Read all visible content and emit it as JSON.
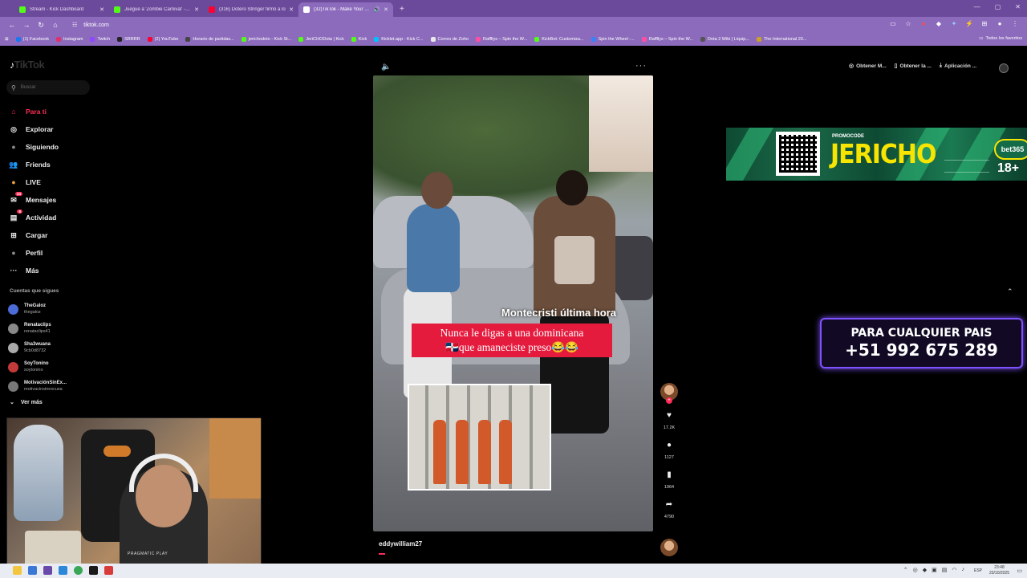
{
  "browser": {
    "tabs": [
      {
        "title": "Stream - Kick Dashboard",
        "color": "#53fc18",
        "active": false
      },
      {
        "title": "Juegue a 'Zombie Carnival' - Ju",
        "color": "#53fc18",
        "active": false
      },
      {
        "title": "(316) Dotero Stringer firmó a lo",
        "color": "#ff0033",
        "active": false
      },
      {
        "title": "(32)TikTok - Make Your Day",
        "color": "#ffffff",
        "active": true
      }
    ],
    "url": "tiktok.com",
    "bookmarks": [
      {
        "label": "(1) Facebook",
        "color": "#1877f2"
      },
      {
        "label": "Instagram",
        "color": "#e1306c"
      },
      {
        "label": "Twitch",
        "color": "#9146ff"
      },
      {
        "label": "SRRRR",
        "color": "#222222"
      },
      {
        "label": "(2) YouTube",
        "color": "#ff0033"
      },
      {
        "label": "Horario de partidas...",
        "color": "#444444"
      },
      {
        "label": "jerichodoto - Kick St...",
        "color": "#53fc18"
      },
      {
        "label": "JeriCHODota | Kick",
        "color": "#53fc18"
      },
      {
        "label": "Kick",
        "color": "#53fc18"
      },
      {
        "label": "Kicklet.app - Kick C...",
        "color": "#00c2ff"
      },
      {
        "label": "Correo de Zoho",
        "color": "#e8e8e8"
      },
      {
        "label": "Raffllys – Spin the W...",
        "color": "#ff4fa3"
      },
      {
        "label": "KickBot: Customiza...",
        "color": "#53fc18"
      },
      {
        "label": "Spin the Wheel -...",
        "color": "#3b82f6"
      },
      {
        "label": "Raffllys – Spin the W...",
        "color": "#ff4fa3"
      },
      {
        "label": "Dota 2 Wiki | Liquip...",
        "color": "#555555"
      },
      {
        "label": "The International 20...",
        "color": "#c9a227"
      }
    ],
    "all_bookmarks": "Todos los favoritos"
  },
  "tiktok": {
    "logo": "TikTok",
    "search_placeholder": "Buscar",
    "nav": [
      {
        "label": "Para ti",
        "icon": "home-icon",
        "glyph": "⌂",
        "active": true
      },
      {
        "label": "Explorar",
        "icon": "compass-icon",
        "glyph": "◎",
        "active": false
      },
      {
        "label": "Siguiendo",
        "icon": "following-icon",
        "glyph": "●",
        "active": false
      },
      {
        "label": "Friends",
        "icon": "friends-icon",
        "glyph": "👥",
        "active": false
      },
      {
        "label": "LIVE",
        "icon": "live-icon",
        "glyph": "●",
        "active": false
      },
      {
        "label": "Mensajes",
        "icon": "messages-icon",
        "glyph": "✉",
        "badge": "24",
        "active": false
      },
      {
        "label": "Actividad",
        "icon": "activity-icon",
        "glyph": "▤",
        "badge": "8",
        "active": false
      },
      {
        "label": "Cargar",
        "icon": "upload-icon",
        "glyph": "⊞",
        "active": false
      },
      {
        "label": "Perfil",
        "icon": "profile-icon",
        "glyph": "●",
        "active": false
      },
      {
        "label": "Más",
        "icon": "more-icon",
        "glyph": "···",
        "active": false
      }
    ],
    "following_title": "Cuentas que sigues",
    "following": [
      {
        "name": "TheGaloz",
        "handle": "thegaloz",
        "color": "#4b6cd6"
      },
      {
        "name": "Renataclips",
        "handle": "renataclips41",
        "color": "#888888"
      },
      {
        "name": "Sha3wuana",
        "handle": "9cb0d8732",
        "color": "#aaaaaa"
      },
      {
        "name": "SoyTonino",
        "handle": "soytonino",
        "color": "#c33a3a"
      },
      {
        "name": "MotivaciónSinEx...",
        "handle": "motivacinsinexcusa",
        "color": "#777777"
      }
    ],
    "see_more": "Ver más",
    "top_actions": [
      {
        "label": "Obtener M...",
        "icon": "coin-icon",
        "glyph": "◎"
      },
      {
        "label": "Obtener la ...",
        "icon": "device-icon",
        "glyph": "▯"
      },
      {
        "label": "Aplicación ...",
        "icon": "download-icon",
        "glyph": "⤓"
      }
    ],
    "video": {
      "caption_location": "Montecristi última hora",
      "caption_line1": "Nunca le digas a una dominicana",
      "caption_line2": "🇩🇴que amaneciste preso😂😂",
      "username": "eddywilliam27"
    },
    "rail": {
      "likes": "17.2K",
      "comments": "1127",
      "saves": "1964",
      "shares": "4790"
    }
  },
  "ads": {
    "promo_label": "PROMOCODE",
    "promo_code": "JERICHO",
    "brand": "bet365",
    "age": "18+",
    "phone_line1": "PARA CUALQUIER PAIS",
    "phone_line2": "+51 992 675 289"
  },
  "webcam": {
    "watermark": "PRAGMATIC PLAY"
  },
  "taskbar": {
    "lang": "ESP",
    "time": "23:48",
    "date": "23/10/2025"
  }
}
